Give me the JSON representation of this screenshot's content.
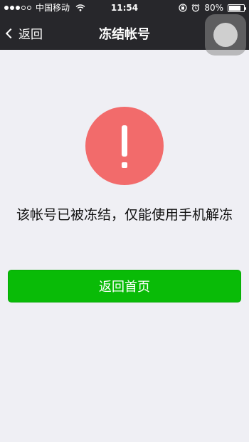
{
  "status_bar": {
    "carrier": "中国移动",
    "time": "11:54",
    "battery_percent": "80%",
    "battery_level": 0.8,
    "icons": [
      "signal-dots-icon",
      "wifi-icon",
      "lock-rotation-icon",
      "alarm-icon",
      "battery-icon"
    ]
  },
  "nav": {
    "back_label": "返回",
    "title": "冻结帐号"
  },
  "content": {
    "alert_icon": "exclamation-icon",
    "message": "该帐号已被冻结，仅能使用手机解冻",
    "primary_button": "返回首页"
  },
  "colors": {
    "nav_background": "#27272b",
    "page_background": "#efeff4",
    "alert_red": "#f26b6b",
    "button_green": "#09bb07"
  }
}
